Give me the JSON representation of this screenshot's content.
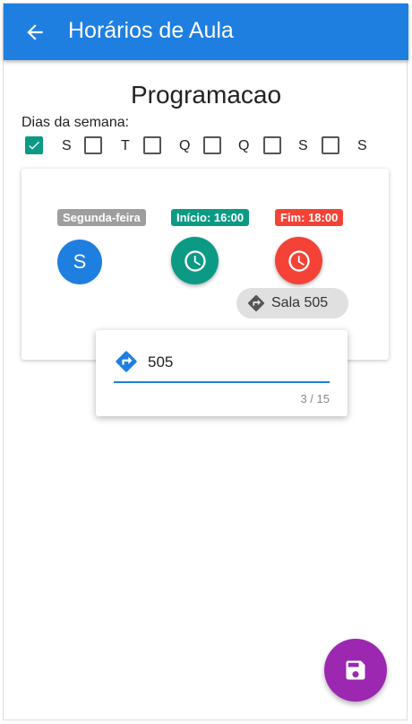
{
  "appbar": {
    "title": "Horários de Aula",
    "back_icon": "arrow-left-icon",
    "color": "#1e7fe0"
  },
  "page_title": "Programacao",
  "days": {
    "label": "Dias da semana:",
    "items": [
      {
        "letter": "S",
        "checked": true
      },
      {
        "letter": "T",
        "checked": false
      },
      {
        "letter": "Q",
        "checked": false
      },
      {
        "letter": "Q",
        "checked": false
      },
      {
        "letter": "S",
        "checked": false
      },
      {
        "letter": "S",
        "checked": false
      }
    ],
    "check_color": "#0c9a85"
  },
  "schedule_card": {
    "day": {
      "label": "Segunda-feira",
      "initial": "S",
      "label_color": "#9e9e9e",
      "circle_color": "#1e7fe0"
    },
    "start": {
      "label": "Início: 16:00",
      "icon": "clock-icon",
      "color": "#0c9a85"
    },
    "end": {
      "label": "Fim: 18:00",
      "icon": "clock-icon",
      "color": "#f44336"
    },
    "room": {
      "label": "Sala 505",
      "icon": "directions-icon"
    }
  },
  "room_editor": {
    "value": "505",
    "counter": "3 / 15",
    "icon": "directions-icon"
  },
  "fab": {
    "icon": "save-icon",
    "color": "#9c27b0"
  }
}
